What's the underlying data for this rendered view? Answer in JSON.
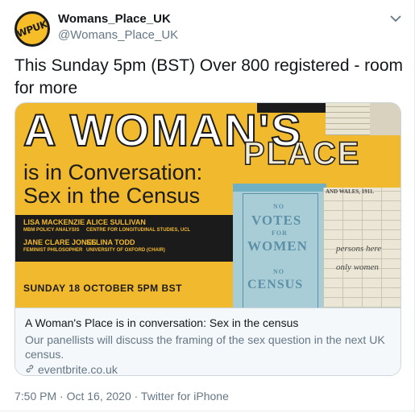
{
  "user": {
    "avatar_text": "WPUK",
    "display_name": "Womans_Place_UK",
    "handle": "@Womans_Place_UK"
  },
  "tweet": {
    "text": "This Sunday 5pm (BST) Over 800 registered - room for more",
    "meta": "7:50 PM · Oct 16, 2020 · Twitter for iPhone"
  },
  "card": {
    "image": {
      "headline_big": "A WOMAN'S",
      "headline_place": "PLACE",
      "subhead_line1": "is in Conversation:",
      "subhead_line2": "Sex in the Census",
      "speakers": [
        {
          "name": "LISA MACKENZIE",
          "role": "MBM POLICY ANALYSIS"
        },
        {
          "name": "ALICE SULLIVAN",
          "role": "CENTRE FOR LONGITUDINAL STUDIES, UCL"
        },
        {
          "name": "JANE CLARE JONES",
          "role": "FEMINIST PHILOSOPHER"
        },
        {
          "name": "SELINA TODD",
          "role": "UNIVERSITY OF OXFORD (CHAIR)"
        }
      ],
      "event_date": "SUNDAY 18 OCTOBER  5PM  BST",
      "census_lines": [
        "NO",
        "VOTES",
        "FOR",
        "WOMEN",
        "NO",
        "CENSUS"
      ],
      "form_header": "AND WALES, 1911.",
      "script_1": "persons here",
      "script_2": "only women"
    },
    "title": "A Woman's Place is in conversation: Sex in the census",
    "description": "Our panellists will discuss the framing of the sex question in the next UK census.",
    "link": "eventbrite.co.uk"
  },
  "colors": {
    "brand_yellow": "#f1b92d",
    "text_primary": "#14171a",
    "text_secondary": "#657786"
  },
  "icons": {
    "caret": "chevron-down-icon",
    "link": "link-icon"
  }
}
